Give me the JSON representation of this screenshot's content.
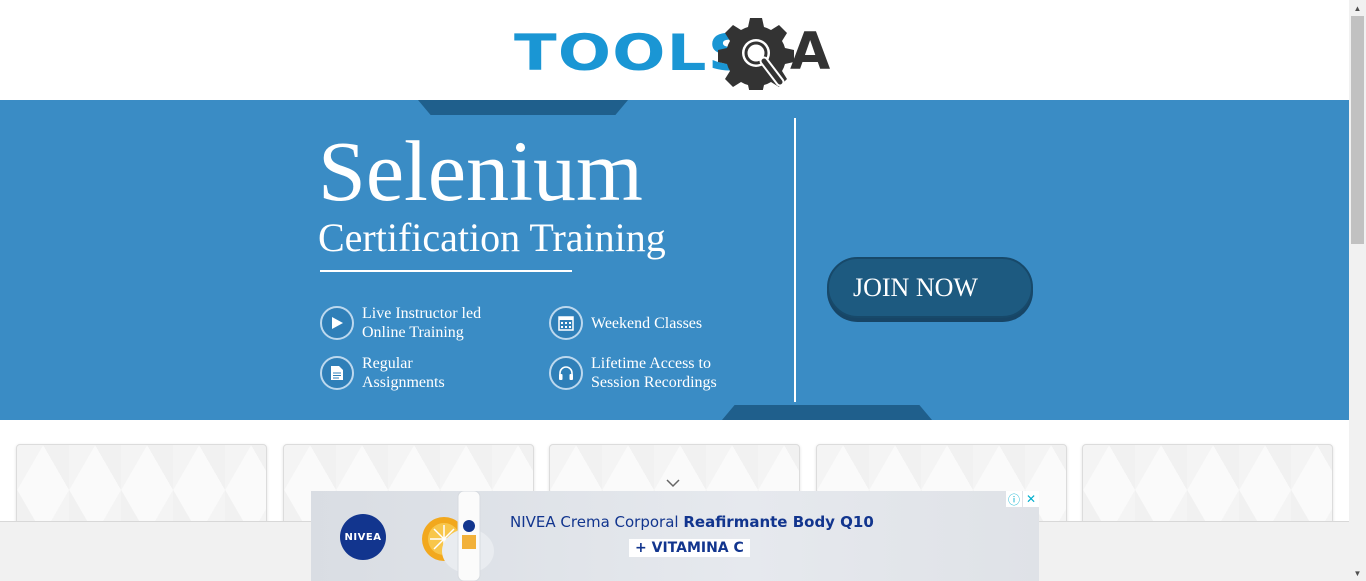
{
  "header": {
    "logo_text_left": "TOOLS",
    "logo_text_right": "A"
  },
  "banner": {
    "title": "Selenium",
    "subtitle": "Certification Training",
    "features": [
      {
        "label": "Live Instructor led\nOnline Training",
        "icon": "play-icon"
      },
      {
        "label": "Weekend Classes",
        "icon": "calendar-icon"
      },
      {
        "label": "Regular\nAssignments",
        "icon": "document-icon"
      },
      {
        "label": "Lifetime Access to\nSession Recordings",
        "icon": "headphones-icon"
      }
    ],
    "join_label": "JOIN NOW"
  },
  "ad": {
    "brand": "NIVEA",
    "line1_regular": "NIVEA Crema Corporal ",
    "line1_bold": "Reafirmante Body Q10",
    "line2": "+ VITAMINA C",
    "info_glyph": "ⓘ",
    "close_glyph": "✕"
  },
  "colors": {
    "banner_bg": "#3a8cc5",
    "button_bg": "#1d5a80",
    "logo_blue": "#1a96d4"
  }
}
